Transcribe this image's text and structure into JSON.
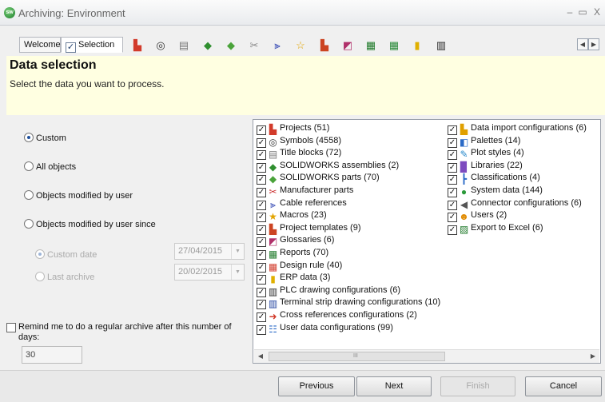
{
  "window": {
    "title": "Archiving: Environment",
    "logo_text": "sw",
    "minimize": "–",
    "maximize": "▭",
    "close": "X"
  },
  "tabs": {
    "welcome": "Welcome",
    "selection": "Selection",
    "selection_checked": true,
    "selection_check_glyph": "✓",
    "scroll_left": "◀",
    "scroll_right": "▶"
  },
  "header": {
    "title": "Data selection",
    "subtitle": "Select the data you want to process."
  },
  "options": {
    "custom": "Custom",
    "all_objects": "All objects",
    "modified_by_user": "Objects modified by user",
    "modified_since": "Objects modified by user since",
    "custom_date": "Custom date",
    "last_archive": "Last archive",
    "custom_date_value": "27/04/2015",
    "last_archive_value": "20/02/2015",
    "dropdown_glyph": "▼",
    "remind_label": "Remind me to do a regular archive after this number of days:",
    "remind_days": "30"
  },
  "list": {
    "check_glyph": "✓",
    "column1": [
      {
        "label": "Projects (51)",
        "icon": "projects-icon",
        "glyph": "▙",
        "color": "#d23b2b"
      },
      {
        "label": "Symbols (4558)",
        "icon": "symbols-icon",
        "glyph": "◎",
        "color": "#333333"
      },
      {
        "label": "Title blocks (72)",
        "icon": "title-blocks-icon",
        "glyph": "▤",
        "color": "#777777"
      },
      {
        "label": "SOLIDWORKS assemblies (2)",
        "icon": "assembly-icon",
        "glyph": "◆",
        "color": "#2f8f2f"
      },
      {
        "label": "SOLIDWORKS parts (70)",
        "icon": "part-icon",
        "glyph": "◆",
        "color": "#4aa33a"
      },
      {
        "label": "Manufacturer parts",
        "icon": "manufacturer-parts-icon",
        "glyph": "✂",
        "color": "#cc3333"
      },
      {
        "label": "Cable references",
        "icon": "cable-references-icon",
        "glyph": "⫸",
        "color": "#2a3fb0"
      },
      {
        "label": "Macros (23)",
        "icon": "macros-icon",
        "glyph": "★",
        "color": "#e2a400"
      },
      {
        "label": "Project templates (9)",
        "icon": "project-templates-icon",
        "glyph": "▙",
        "color": "#cc4422"
      },
      {
        "label": "Glossaries (6)",
        "icon": "glossaries-icon",
        "glyph": "◩",
        "color": "#b0306a"
      },
      {
        "label": "Reports (70)",
        "icon": "reports-icon",
        "glyph": "▦",
        "color": "#1f7a2a"
      },
      {
        "label": "Design rule (40)",
        "icon": "design-rule-icon",
        "glyph": "▦",
        "color": "#d13a2a"
      },
      {
        "label": "ERP data (3)",
        "icon": "erp-data-icon",
        "glyph": "▮",
        "color": "#e0b000"
      },
      {
        "label": "PLC drawing configurations (6)",
        "icon": "plc-icon",
        "glyph": "▥",
        "color": "#222222"
      },
      {
        "label": "Terminal strip drawing configurations (10)",
        "icon": "terminal-strip-icon",
        "glyph": "▥",
        "color": "#1a3c9c"
      },
      {
        "label": "Cross references configurations (2)",
        "icon": "cross-references-icon",
        "glyph": "➜",
        "color": "#d23b2b"
      },
      {
        "label": "User data configurations (99)",
        "icon": "user-data-icon",
        "glyph": "☷",
        "color": "#2a6ac7"
      }
    ],
    "column2": [
      {
        "label": "Data import configurations (6)",
        "icon": "data-import-icon",
        "glyph": "▙",
        "color": "#e0a000"
      },
      {
        "label": "Palettes (14)",
        "icon": "palettes-icon",
        "glyph": "◧",
        "color": "#2a6ac7"
      },
      {
        "label": "Plot styles (4)",
        "icon": "plot-styles-icon",
        "glyph": "✎",
        "color": "#2a8acb"
      },
      {
        "label": "Libraries (22)",
        "icon": "libraries-icon",
        "glyph": "▉",
        "color": "#7d4bbf"
      },
      {
        "label": "Classifications (4)",
        "icon": "classifications-icon",
        "glyph": "┣",
        "color": "#2a6ac7"
      },
      {
        "label": "System data (144)",
        "icon": "system-data-icon",
        "glyph": "●",
        "color": "#2a9a3a"
      },
      {
        "label": "Connector configurations (6)",
        "icon": "connector-icon",
        "glyph": "◀",
        "color": "#555555"
      },
      {
        "label": "Users (2)",
        "icon": "users-icon",
        "glyph": "☻",
        "color": "#e08a00"
      },
      {
        "label": "Export to Excel (6)",
        "icon": "export-excel-icon",
        "glyph": "▨",
        "color": "#1f7a2a"
      }
    ],
    "scroll_left": "◀",
    "scroll_right": "▶",
    "scroll_grip": "III"
  },
  "buttons": {
    "previous": "Previous",
    "next": "Next",
    "finish": "Finish",
    "cancel": "Cancel"
  },
  "toolbar_icons": [
    {
      "name": "projects-icon",
      "glyph": "▙",
      "color": "#d23b2b"
    },
    {
      "name": "symbols-icon",
      "glyph": "◎",
      "color": "#333333"
    },
    {
      "name": "title-blocks-icon",
      "glyph": "▤",
      "color": "#777777"
    },
    {
      "name": "assembly-icon",
      "glyph": "◆",
      "color": "#2f8f2f"
    },
    {
      "name": "part-icon",
      "glyph": "◆",
      "color": "#4aa33a"
    },
    {
      "name": "manufacturer-parts-icon",
      "glyph": "✂",
      "color": "#888888"
    },
    {
      "name": "cable-references-icon",
      "glyph": "⫸",
      "color": "#2a3fb0"
    },
    {
      "name": "macros-icon",
      "glyph": "☆",
      "color": "#e2a400"
    },
    {
      "name": "project-templates-icon",
      "glyph": "▙",
      "color": "#cc4422"
    },
    {
      "name": "glossaries-icon",
      "glyph": "◩",
      "color": "#b0306a"
    },
    {
      "name": "reports-icon",
      "glyph": "▦",
      "color": "#1f7a2a"
    },
    {
      "name": "design-rule-icon",
      "glyph": "▦",
      "color": "#2a8a3a"
    },
    {
      "name": "erp-data-icon",
      "glyph": "▮",
      "color": "#e0b000"
    },
    {
      "name": "plc-icon",
      "glyph": "▥",
      "color": "#222222"
    }
  ]
}
